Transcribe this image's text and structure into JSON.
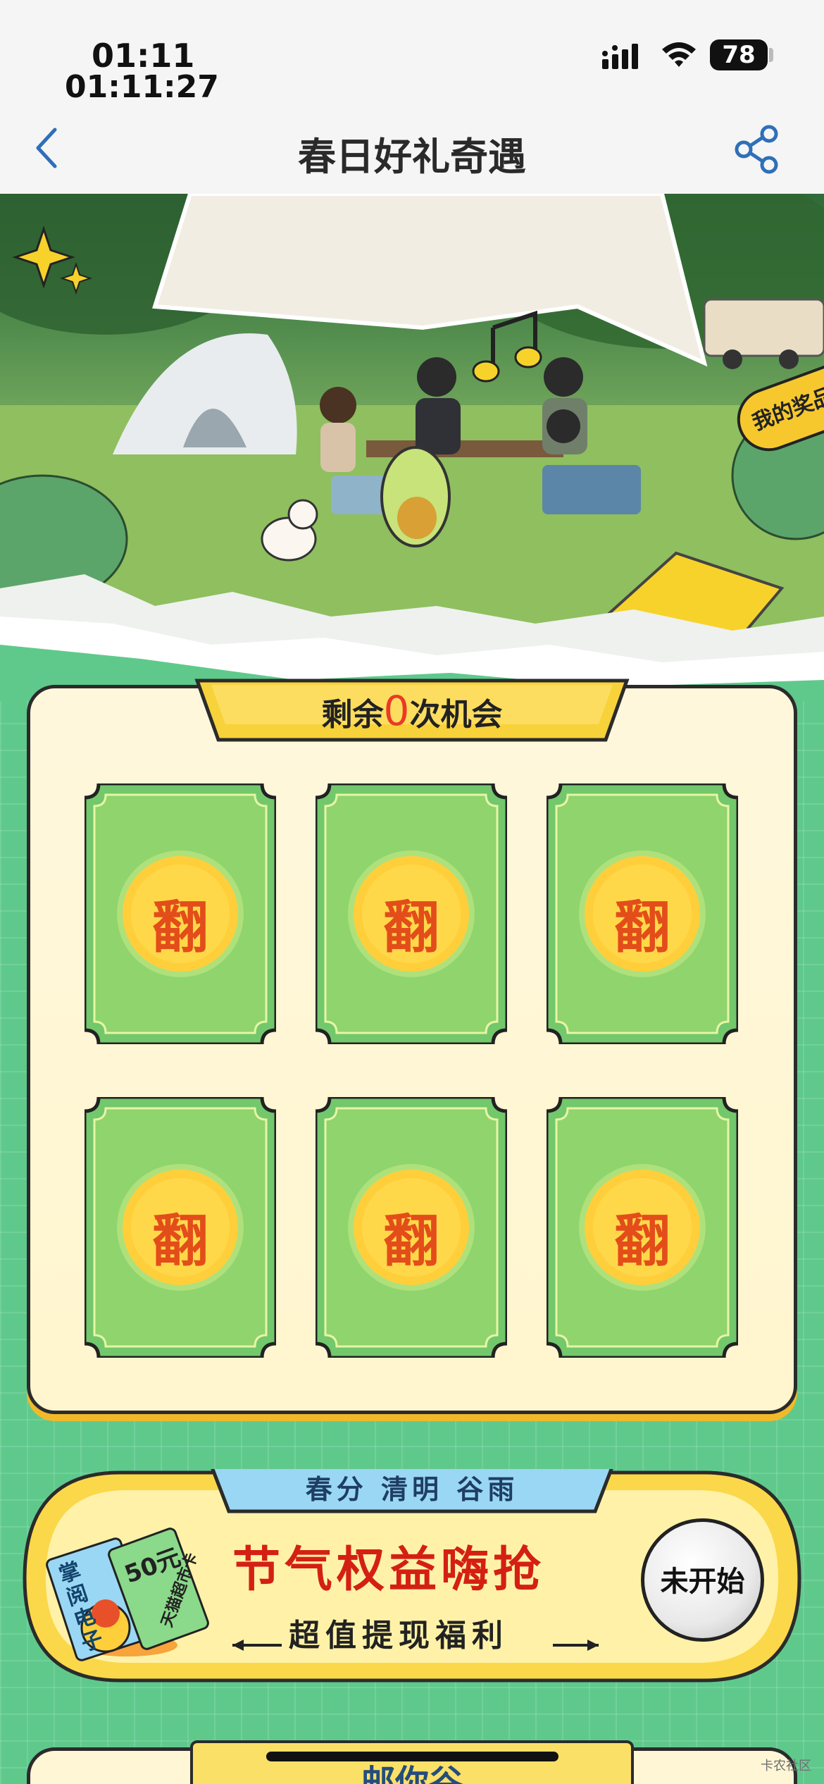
{
  "status_bar": {
    "time": "01:11",
    "time_seconds": "01:11:27",
    "battery": "78",
    "icons": [
      "signal-icon",
      "wifi-icon",
      "battery-icon"
    ]
  },
  "nav": {
    "title": "春日好礼奇遇",
    "back_icon": "chevron-left-icon",
    "share_icon": "share-icon"
  },
  "hero": {
    "my_prize_label": "我的奖品"
  },
  "game": {
    "remaining_prefix": "剩余",
    "remaining_count": "0",
    "remaining_suffix": "次机会",
    "cards": [
      {
        "label": "翻"
      },
      {
        "label": "翻"
      },
      {
        "label": "翻"
      },
      {
        "label": "翻"
      },
      {
        "label": "翻"
      },
      {
        "label": "翻"
      }
    ]
  },
  "festival": {
    "tag": "春分 清明 谷雨",
    "title": "节气权益嗨抢",
    "subtitle": "超值提现福利",
    "button": "未开始",
    "ticket_1": "掌阅电子",
    "ticket_2": "50元",
    "ticket_3": "天猫超市卡",
    "colors": {
      "title": "#d42014",
      "button_bg": "#e9e9e9",
      "banner": "#f8d84a"
    }
  },
  "next_section": {
    "title": "邮你谷"
  },
  "watermark": "卡农社区"
}
